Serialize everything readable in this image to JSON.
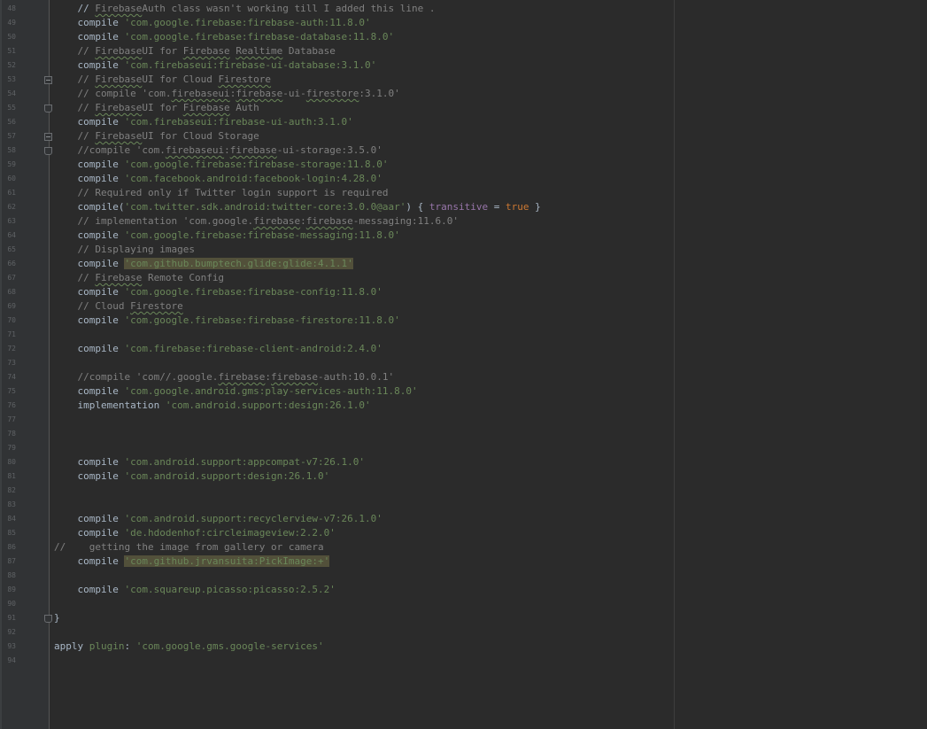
{
  "editor": {
    "language": "groovy",
    "colors": {
      "background": "#2b2b2b",
      "gutter": "#313335",
      "line_number": "#5f6265",
      "plain": "#a9b7c6",
      "comment": "#808080",
      "string": "#6a8759",
      "keyword": "#cc7832",
      "property": "#9876aa",
      "highlight": "#52503a"
    },
    "lines": [
      {
        "num": "48",
        "text": "    // FirebaseAuth class wasn't working till I added this line .",
        "tokens": [
          {
            "t": "    // "
          },
          {
            "t": "Firebase",
            "c": "c typo"
          },
          {
            "t": "Auth class wasn't working till I added this line .",
            "c": "c"
          }
        ],
        "fold": "none"
      },
      {
        "num": "49",
        "text": "    compile 'com.google.firebase:firebase-auth:11.8.0'",
        "tokens": [
          {
            "t": "    compile "
          },
          {
            "t": "'com.google.firebase:firebase-auth:11.8.0'",
            "c": "s"
          }
        ],
        "fold": "none"
      },
      {
        "num": "50",
        "text": "    compile 'com.google.firebase:firebase-database:11.8.0'",
        "tokens": [
          {
            "t": "    compile "
          },
          {
            "t": "'com.google.firebase:firebase-database:11.8.0'",
            "c": "s"
          }
        ],
        "fold": "none"
      },
      {
        "num": "51",
        "text": "    // FirebaseUI for Firebase Realtime Database",
        "tokens": [
          {
            "t": "    // ",
            "c": "c"
          },
          {
            "t": "Firebase",
            "c": "c typo"
          },
          {
            "t": "UI for ",
            "c": "c"
          },
          {
            "t": "Firebase",
            "c": "c typo"
          },
          {
            "t": " ",
            "c": "c"
          },
          {
            "t": "Realtime",
            "c": "c typo"
          },
          {
            "t": " Database",
            "c": "c"
          }
        ],
        "fold": "none"
      },
      {
        "num": "52",
        "text": "    compile 'com.firebaseui:firebase-ui-database:3.1.0'",
        "tokens": [
          {
            "t": "    compile "
          },
          {
            "t": "'com.firebaseui:firebase-ui-database:3.1.0'",
            "c": "s"
          }
        ],
        "fold": "none"
      },
      {
        "num": "53",
        "text": "    // FirebaseUI for Cloud Firestore",
        "tokens": [
          {
            "t": "    // ",
            "c": "c"
          },
          {
            "t": "Firebase",
            "c": "c typo"
          },
          {
            "t": "UI for Cloud ",
            "c": "c"
          },
          {
            "t": "Firestore",
            "c": "c typo"
          }
        ],
        "fold": "start"
      },
      {
        "num": "54",
        "text": "    // compile 'com.firebaseui:firebase-ui-firestore:3.1.0'",
        "tokens": [
          {
            "t": "    // compile 'com.",
            "c": "c"
          },
          {
            "t": "firebaseui",
            "c": "c typo"
          },
          {
            "t": ":",
            "c": "c"
          },
          {
            "t": "firebase",
            "c": "c typo"
          },
          {
            "t": "-ui-",
            "c": "c"
          },
          {
            "t": "firestore",
            "c": "c typo"
          },
          {
            "t": ":3.1.0'",
            "c": "c"
          }
        ],
        "fold": "none"
      },
      {
        "num": "55",
        "text": "    // FirebaseUI for Firebase Auth",
        "tokens": [
          {
            "t": "    // ",
            "c": "c"
          },
          {
            "t": "Firebase",
            "c": "c typo"
          },
          {
            "t": "UI for ",
            "c": "c"
          },
          {
            "t": "Firebase",
            "c": "c typo"
          },
          {
            "t": " Auth",
            "c": "c"
          }
        ],
        "fold": "end"
      },
      {
        "num": "56",
        "text": "    compile 'com.firebaseui:firebase-ui-auth:3.1.0'",
        "tokens": [
          {
            "t": "    compile "
          },
          {
            "t": "'com.firebaseui:firebase-ui-auth:3.1.0'",
            "c": "s"
          }
        ],
        "fold": "none"
      },
      {
        "num": "57",
        "text": "    // FirebaseUI for Cloud Storage",
        "tokens": [
          {
            "t": "    // ",
            "c": "c"
          },
          {
            "t": "Firebase",
            "c": "c typo"
          },
          {
            "t": "UI for Cloud Storage",
            "c": "c"
          }
        ],
        "fold": "start"
      },
      {
        "num": "58",
        "text": "    //compile 'com.firebaseui:firebase-ui-storage:3.5.0'",
        "tokens": [
          {
            "t": "    //compile 'com.",
            "c": "c"
          },
          {
            "t": "firebaseui",
            "c": "c typo"
          },
          {
            "t": ":",
            "c": "c"
          },
          {
            "t": "firebase",
            "c": "c typo"
          },
          {
            "t": "-ui-storage:3.5.0'",
            "c": "c"
          }
        ],
        "fold": "end"
      },
      {
        "num": "59",
        "text": "    compile 'com.google.firebase:firebase-storage:11.8.0'",
        "tokens": [
          {
            "t": "    compile "
          },
          {
            "t": "'com.google.firebase:firebase-storage:11.8.0'",
            "c": "s"
          }
        ],
        "fold": "none"
      },
      {
        "num": "60",
        "text": "    compile 'com.facebook.android:facebook-login:4.28.0'",
        "tokens": [
          {
            "t": "    compile "
          },
          {
            "t": "'com.facebook.android:facebook-login:4.28.0'",
            "c": "s"
          }
        ],
        "fold": "none"
      },
      {
        "num": "61",
        "text": "    // Required only if Twitter login support is required",
        "tokens": [
          {
            "t": "    // Required only if Twitter login support is required",
            "c": "c"
          }
        ],
        "fold": "none"
      },
      {
        "num": "62",
        "text": "    compile('com.twitter.sdk.android:twitter-core:3.0.0@aar') { transitive = true }",
        "tokens": [
          {
            "t": "    compile("
          },
          {
            "t": "'com.twitter.sdk.android:twitter-core:3.0.0@aar'",
            "c": "s"
          },
          {
            "t": ") { "
          },
          {
            "t": "transitive",
            "c": "p"
          },
          {
            "t": " = "
          },
          {
            "t": "true",
            "c": "k"
          },
          {
            "t": " }"
          }
        ],
        "fold": "none"
      },
      {
        "num": "63",
        "text": "    // implementation 'com.google.firebase:firebase-messaging:11.6.0'",
        "tokens": [
          {
            "t": "    // implementation 'com.google.",
            "c": "c"
          },
          {
            "t": "firebase",
            "c": "c typo"
          },
          {
            "t": ":",
            "c": "c"
          },
          {
            "t": "firebase",
            "c": "c typo"
          },
          {
            "t": "-messaging:11.6.0'",
            "c": "c"
          }
        ],
        "fold": "none"
      },
      {
        "num": "64",
        "text": "    compile 'com.google.firebase:firebase-messaging:11.8.0'",
        "tokens": [
          {
            "t": "    compile "
          },
          {
            "t": "'com.google.firebase:firebase-messaging:11.8.0'",
            "c": "s"
          }
        ],
        "fold": "none"
      },
      {
        "num": "65",
        "text": "    // Displaying images",
        "tokens": [
          {
            "t": "    // Displaying images",
            "c": "c"
          }
        ],
        "fold": "none"
      },
      {
        "num": "66",
        "text": "    compile 'com.github.bumptech.glide:glide:4.1.1'",
        "tokens": [
          {
            "t": "    compile "
          },
          {
            "t": "'com.github.bumptech.glide:glide:4.1.1'",
            "c": "s hl"
          }
        ],
        "fold": "none"
      },
      {
        "num": "67",
        "text": "    // Firebase Remote Config",
        "tokens": [
          {
            "t": "    // ",
            "c": "c"
          },
          {
            "t": "Firebase",
            "c": "c typo"
          },
          {
            "t": " Remote Config",
            "c": "c"
          }
        ],
        "fold": "none"
      },
      {
        "num": "68",
        "text": "    compile 'com.google.firebase:firebase-config:11.8.0'",
        "tokens": [
          {
            "t": "    compile "
          },
          {
            "t": "'com.google.firebase:firebase-config:11.8.0'",
            "c": "s"
          }
        ],
        "fold": "none"
      },
      {
        "num": "69",
        "text": "    // Cloud Firestore",
        "tokens": [
          {
            "t": "    // Cloud ",
            "c": "c"
          },
          {
            "t": "Firestore",
            "c": "c typo"
          }
        ],
        "fold": "none"
      },
      {
        "num": "70",
        "text": "    compile 'com.google.firebase:firebase-firestore:11.8.0'",
        "tokens": [
          {
            "t": "    compile "
          },
          {
            "t": "'com.google.firebase:firebase-firestore:11.8.0'",
            "c": "s"
          }
        ],
        "fold": "none"
      },
      {
        "num": "71",
        "text": "",
        "tokens": [],
        "fold": "none"
      },
      {
        "num": "72",
        "text": "    compile 'com.firebase:firebase-client-android:2.4.0'",
        "tokens": [
          {
            "t": "    compile "
          },
          {
            "t": "'com.firebase:firebase-client-android:2.4.0'",
            "c": "s"
          }
        ],
        "fold": "none"
      },
      {
        "num": "73",
        "text": "",
        "tokens": [],
        "fold": "none"
      },
      {
        "num": "74",
        "text": "    //compile 'com//.google.firebase:firebase-auth:10.0.1'",
        "tokens": [
          {
            "t": "    //compile 'com//.google.",
            "c": "c"
          },
          {
            "t": "firebase",
            "c": "c typo"
          },
          {
            "t": ":",
            "c": "c"
          },
          {
            "t": "firebase",
            "c": "c typo"
          },
          {
            "t": "-auth:10.0.1'",
            "c": "c"
          }
        ],
        "fold": "none"
      },
      {
        "num": "75",
        "text": "    compile 'com.google.android.gms:play-services-auth:11.8.0'",
        "tokens": [
          {
            "t": "    compile "
          },
          {
            "t": "'com.google.android.gms:play-services-auth:11.8.0'",
            "c": "s"
          }
        ],
        "fold": "none"
      },
      {
        "num": "76",
        "text": "    implementation 'com.android.support:design:26.1.0'",
        "tokens": [
          {
            "t": "    implementation "
          },
          {
            "t": "'com.android.support:design:26.1.0'",
            "c": "s"
          }
        ],
        "fold": "none"
      },
      {
        "num": "77",
        "text": "",
        "tokens": [],
        "fold": "none"
      },
      {
        "num": "78",
        "text": "",
        "tokens": [],
        "fold": "none"
      },
      {
        "num": "79",
        "text": "",
        "tokens": [],
        "fold": "none"
      },
      {
        "num": "80",
        "text": "    compile 'com.android.support:appcompat-v7:26.1.0'",
        "tokens": [
          {
            "t": "    compile "
          },
          {
            "t": "'com.android.support:appcompat-v7:26.1.0'",
            "c": "s"
          }
        ],
        "fold": "none"
      },
      {
        "num": "81",
        "text": "    compile 'com.android.support:design:26.1.0'",
        "tokens": [
          {
            "t": "    compile "
          },
          {
            "t": "'com.android.support:design:26.1.0'",
            "c": "s"
          }
        ],
        "fold": "none"
      },
      {
        "num": "82",
        "text": "",
        "tokens": [],
        "fold": "none"
      },
      {
        "num": "83",
        "text": "",
        "tokens": [],
        "fold": "none"
      },
      {
        "num": "84",
        "text": "    compile 'com.android.support:recyclerview-v7:26.1.0'",
        "tokens": [
          {
            "t": "    compile "
          },
          {
            "t": "'com.android.support:recyclerview-v7:26.1.0'",
            "c": "s"
          }
        ],
        "fold": "none"
      },
      {
        "num": "85",
        "text": "    compile 'de.hdodenhof:circleimageview:2.2.0'",
        "tokens": [
          {
            "t": "    compile "
          },
          {
            "t": "'de.hdodenhof:circleimageview:2.2.0'",
            "c": "s"
          }
        ],
        "fold": "none"
      },
      {
        "num": "86",
        "text": "//    getting the image from gallery or camera",
        "tokens": [
          {
            "t": "//    getting the image from gallery or camera",
            "c": "c"
          }
        ],
        "fold": "none"
      },
      {
        "num": "87",
        "text": "    compile 'com.github.jrvansuita:PickImage:+'",
        "tokens": [
          {
            "t": "    compile "
          },
          {
            "t": "'com.github.jrvansuita:PickImage:+'",
            "c": "s hl"
          }
        ],
        "fold": "none"
      },
      {
        "num": "88",
        "text": "",
        "tokens": [],
        "fold": "none"
      },
      {
        "num": "89",
        "text": "    compile 'com.squareup.picasso:picasso:2.5.2'",
        "tokens": [
          {
            "t": "    compile "
          },
          {
            "t": "'com.squareup.picasso:picasso:2.5.2'",
            "c": "s"
          }
        ],
        "fold": "none"
      },
      {
        "num": "90",
        "text": "",
        "tokens": [],
        "fold": "none"
      },
      {
        "num": "91",
        "text": "}",
        "tokens": [
          {
            "t": "}"
          }
        ],
        "fold": "end"
      },
      {
        "num": "92",
        "text": "",
        "tokens": [],
        "fold": "none"
      },
      {
        "num": "93",
        "text": "apply plugin: 'com.google.gms.google-services'",
        "tokens": [
          {
            "t": "apply "
          },
          {
            "t": "plugin",
            "c": "s"
          },
          {
            "t": ": "
          },
          {
            "t": "'com.google.gms.google-services'",
            "c": "s"
          }
        ],
        "fold": "none"
      },
      {
        "num": "94",
        "text": "",
        "tokens": [],
        "fold": "none"
      }
    ]
  }
}
